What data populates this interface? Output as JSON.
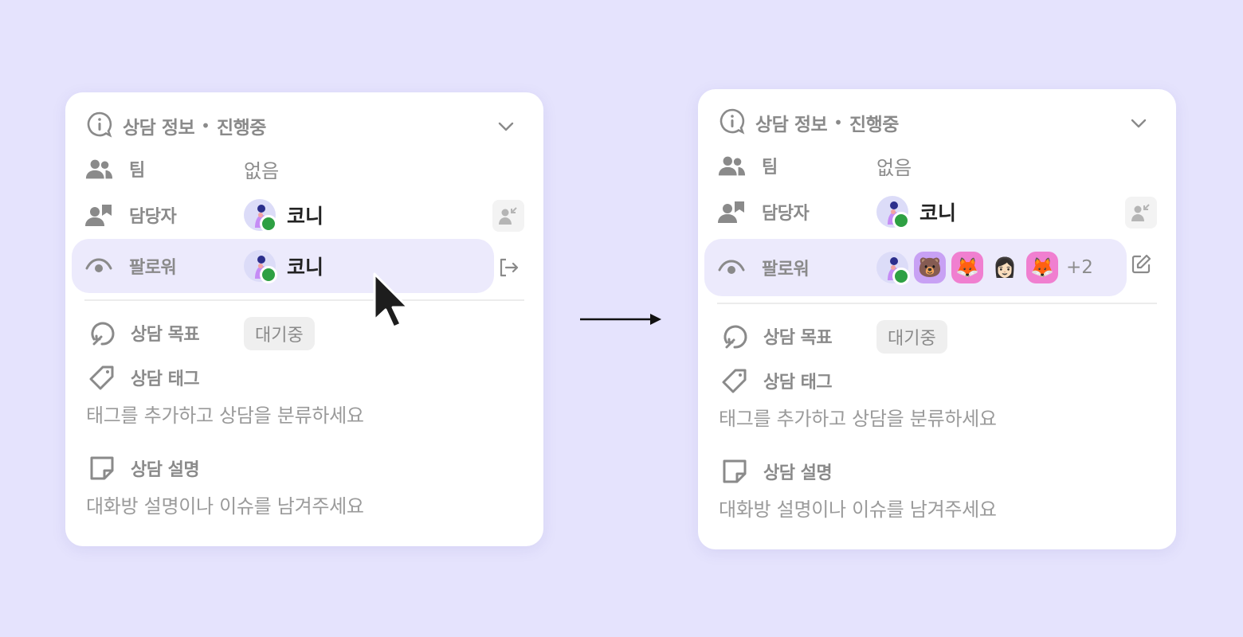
{
  "colors": {
    "background": "#e5e3fd",
    "card": "#ffffff",
    "highlight": "#eceafc",
    "online": "#2ea043"
  },
  "panels": [
    {
      "header": {
        "title": "상담 정보",
        "separator": "•",
        "status": "진행중"
      },
      "team": {
        "label": "팀",
        "value": "없음"
      },
      "assignee": {
        "label": "담당자",
        "name": "코니"
      },
      "follower": {
        "label": "팔로워",
        "name": "코니"
      },
      "goal": {
        "label": "상담 목표",
        "status": "대기중"
      },
      "tags": {
        "label": "상담 태그",
        "placeholder": "태그를 추가하고 상담을 분류하세요"
      },
      "description": {
        "label": "상담 설명",
        "placeholder": "대화방 설명이나 이슈를 남겨주세요"
      }
    },
    {
      "header": {
        "title": "상담 정보",
        "separator": "•",
        "status": "진행중"
      },
      "team": {
        "label": "팀",
        "value": "없음"
      },
      "assignee": {
        "label": "담당자",
        "name": "코니"
      },
      "follower": {
        "label": "팔로워",
        "avatars": [
          "🐻",
          "🦊",
          "👩🏻",
          "🦊"
        ],
        "more": "+2"
      },
      "goal": {
        "label": "상담 목표",
        "status": "대기중"
      },
      "tags": {
        "label": "상담 태그",
        "placeholder": "태그를 추가하고 상담을 분류하세요"
      },
      "description": {
        "label": "상담 설명",
        "placeholder": "대화방 설명이나 이슈를 남겨주세요"
      }
    }
  ]
}
